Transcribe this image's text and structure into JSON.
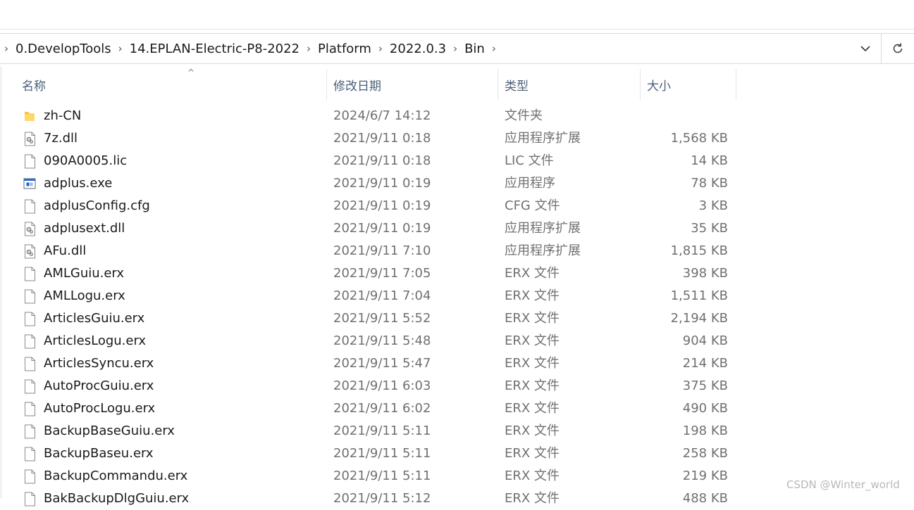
{
  "address": {
    "crumbs": [
      "0.DevelopTools",
      "14.EPLAN-Electric-P8-2022",
      "Platform",
      "2022.0.3",
      "Bin"
    ]
  },
  "columns": {
    "name": "名称",
    "date": "修改日期",
    "type": "类型",
    "size": "大小"
  },
  "files": [
    {
      "name": "zh-CN",
      "date": "2024/6/7 14:12",
      "type": "文件夹",
      "size": "",
      "icon": "folder-icon"
    },
    {
      "name": "7z.dll",
      "date": "2021/9/11 0:18",
      "type": "应用程序扩展",
      "size": "1,568 KB",
      "icon": "dll-file-icon"
    },
    {
      "name": "090A0005.lic",
      "date": "2021/9/11 0:18",
      "type": "LIC 文件",
      "size": "14 KB",
      "icon": "file-icon"
    },
    {
      "name": "adplus.exe",
      "date": "2021/9/11 0:19",
      "type": "应用程序",
      "size": "78 KB",
      "icon": "exe-file-icon"
    },
    {
      "name": "adplusConfig.cfg",
      "date": "2021/9/11 0:19",
      "type": "CFG 文件",
      "size": "3 KB",
      "icon": "file-icon"
    },
    {
      "name": "adplusext.dll",
      "date": "2021/9/11 0:19",
      "type": "应用程序扩展",
      "size": "35 KB",
      "icon": "dll-file-icon"
    },
    {
      "name": "AFu.dll",
      "date": "2021/9/11 7:10",
      "type": "应用程序扩展",
      "size": "1,815 KB",
      "icon": "dll-file-icon"
    },
    {
      "name": "AMLGuiu.erx",
      "date": "2021/9/11 7:05",
      "type": "ERX 文件",
      "size": "398 KB",
      "icon": "file-icon"
    },
    {
      "name": "AMLLogu.erx",
      "date": "2021/9/11 7:04",
      "type": "ERX 文件",
      "size": "1,511 KB",
      "icon": "file-icon"
    },
    {
      "name": "ArticlesGuiu.erx",
      "date": "2021/9/11 5:52",
      "type": "ERX 文件",
      "size": "2,194 KB",
      "icon": "file-icon"
    },
    {
      "name": "ArticlesLogu.erx",
      "date": "2021/9/11 5:48",
      "type": "ERX 文件",
      "size": "904 KB",
      "icon": "file-icon"
    },
    {
      "name": "ArticlesSyncu.erx",
      "date": "2021/9/11 5:47",
      "type": "ERX 文件",
      "size": "214 KB",
      "icon": "file-icon"
    },
    {
      "name": "AutoProcGuiu.erx",
      "date": "2021/9/11 6:03",
      "type": "ERX 文件",
      "size": "375 KB",
      "icon": "file-icon"
    },
    {
      "name": "AutoProcLogu.erx",
      "date": "2021/9/11 6:02",
      "type": "ERX 文件",
      "size": "490 KB",
      "icon": "file-icon"
    },
    {
      "name": "BackupBaseGuiu.erx",
      "date": "2021/9/11 5:11",
      "type": "ERX 文件",
      "size": "198 KB",
      "icon": "file-icon"
    },
    {
      "name": "BackupBaseu.erx",
      "date": "2021/9/11 5:11",
      "type": "ERX 文件",
      "size": "258 KB",
      "icon": "file-icon"
    },
    {
      "name": "BackupCommandu.erx",
      "date": "2021/9/11 5:11",
      "type": "ERX 文件",
      "size": "219 KB",
      "icon": "file-icon"
    },
    {
      "name": "BakBackupDlgGuiu.erx",
      "date": "2021/9/11 5:12",
      "type": "ERX 文件",
      "size": "488 KB",
      "icon": "file-icon"
    }
  ],
  "watermark": "CSDN @Winter_world"
}
